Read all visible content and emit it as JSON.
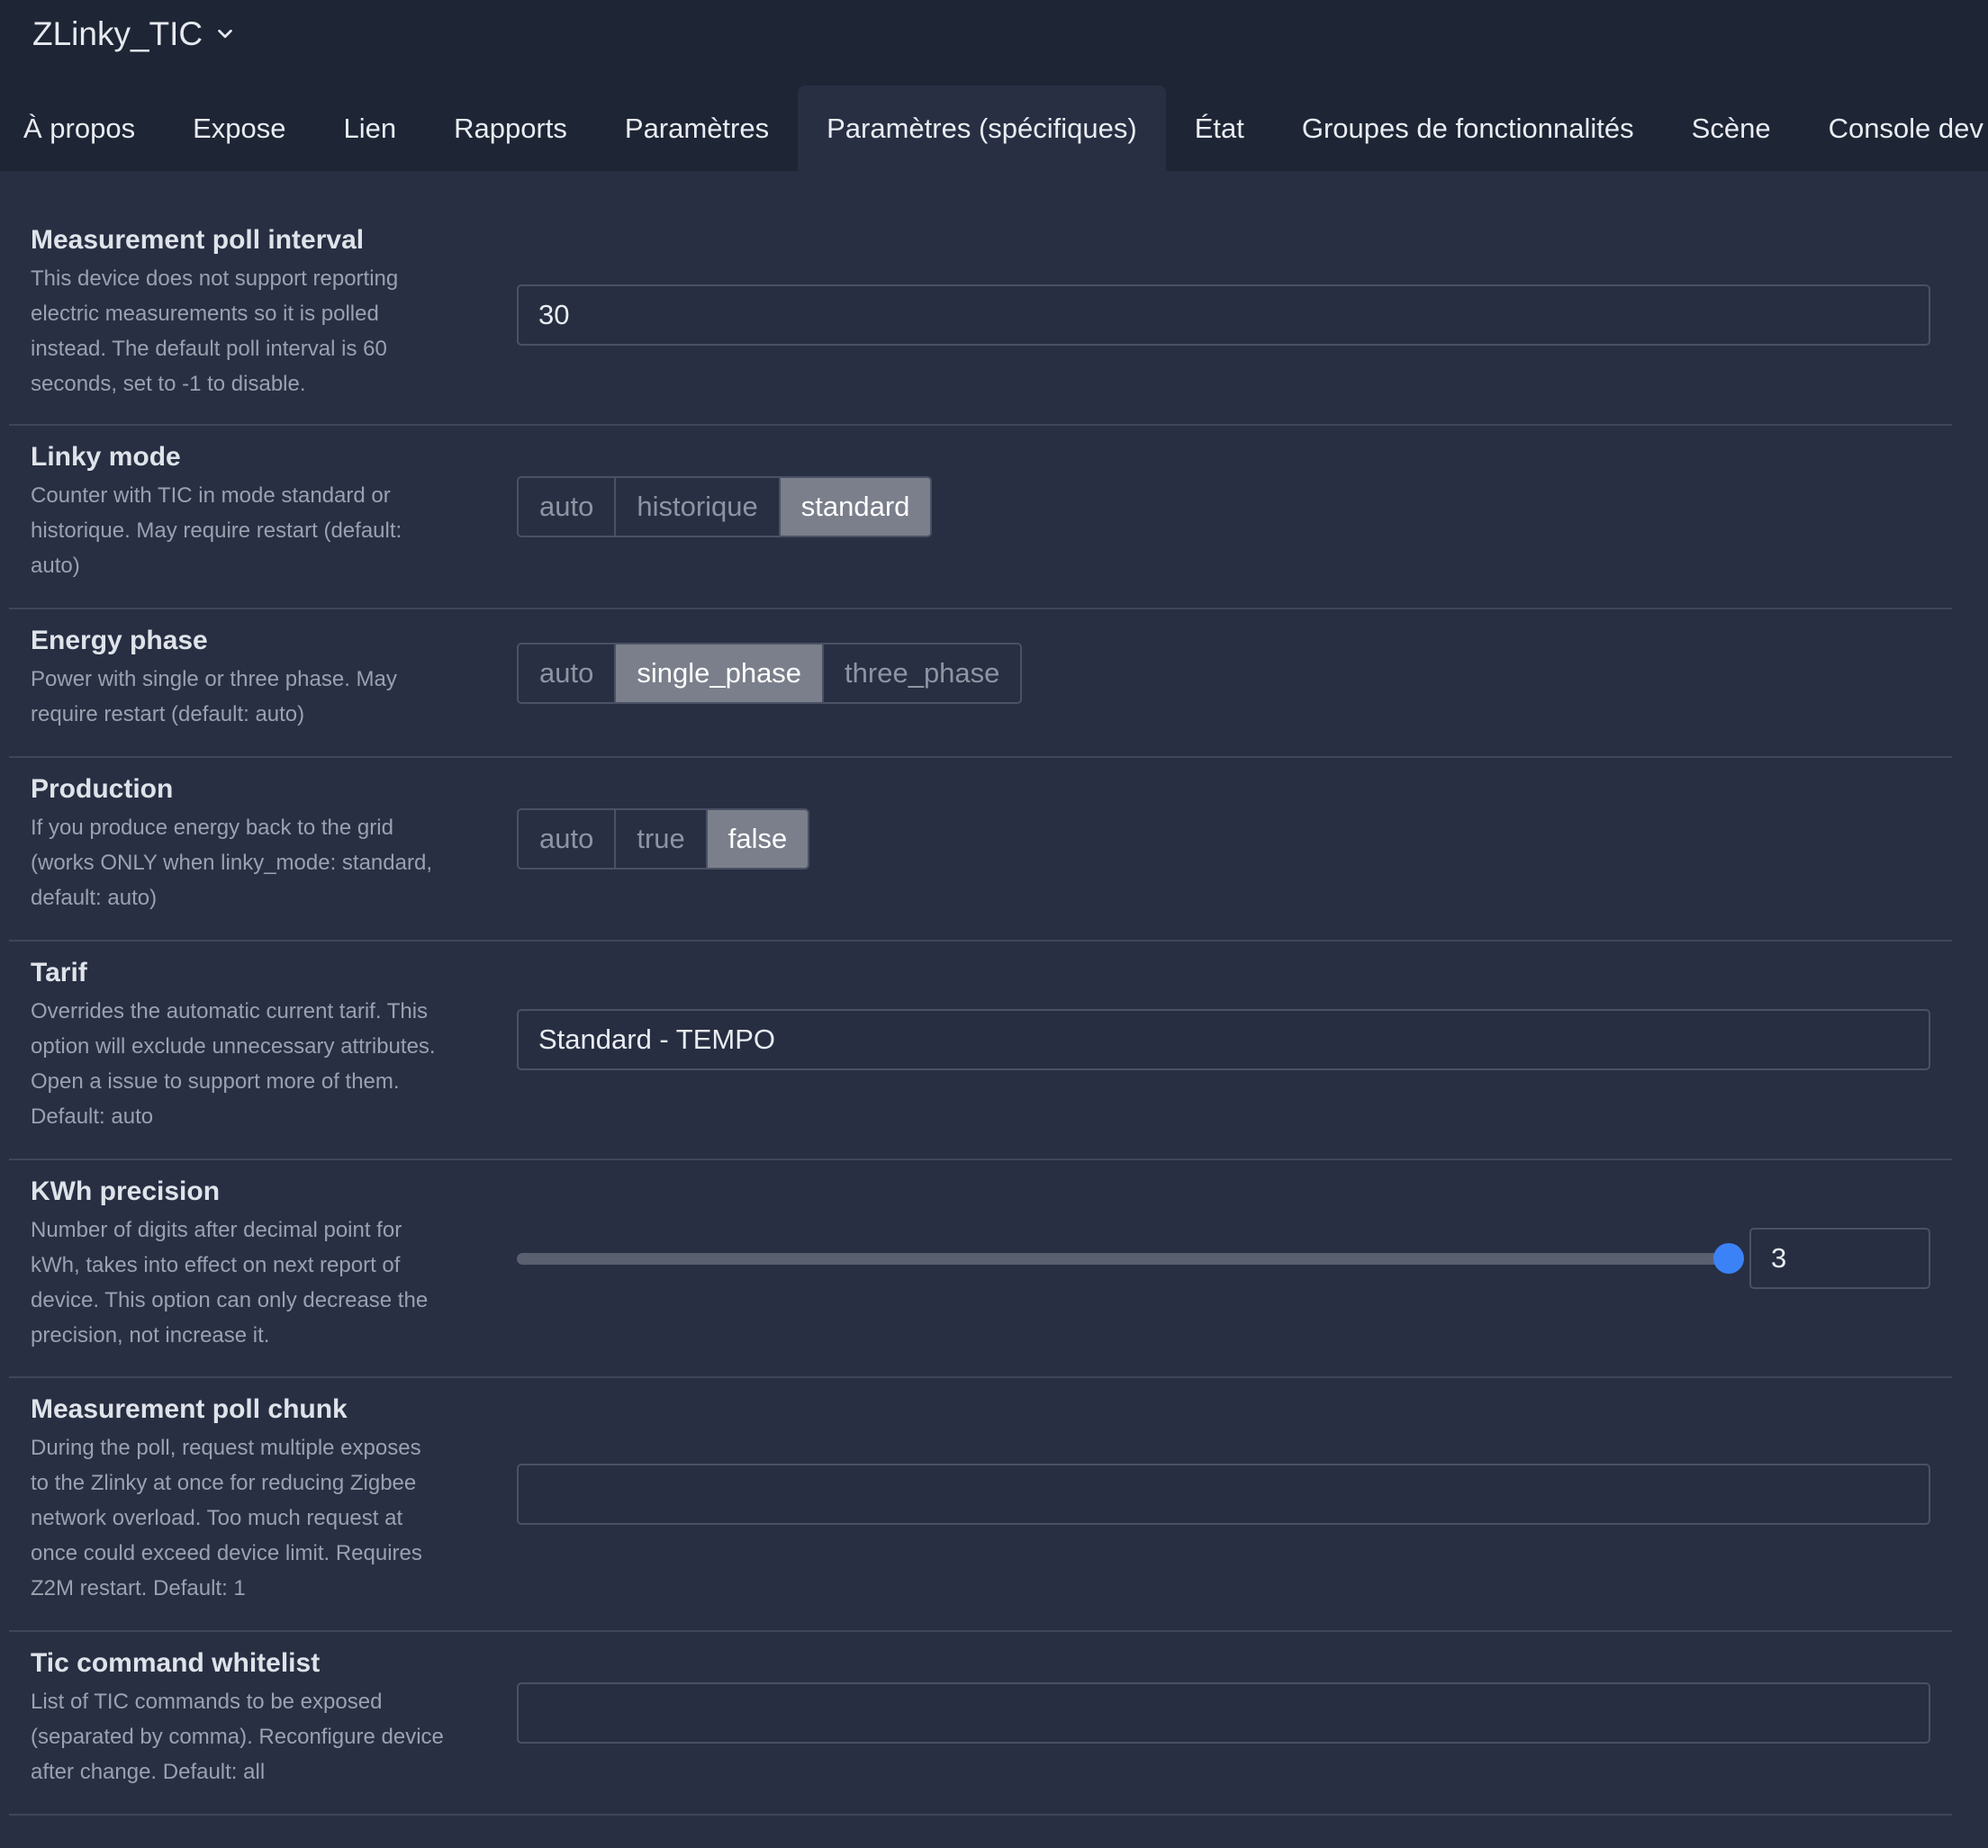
{
  "header": {
    "device_name": "ZLinky_TIC",
    "dropdown_icon": "chevron-down-icon"
  },
  "tabs": [
    {
      "label": "À propos",
      "active": false
    },
    {
      "label": "Expose",
      "active": false
    },
    {
      "label": "Lien",
      "active": false
    },
    {
      "label": "Rapports",
      "active": false
    },
    {
      "label": "Paramètres",
      "active": false
    },
    {
      "label": "Paramètres (spécifiques)",
      "active": true
    },
    {
      "label": "État",
      "active": false
    },
    {
      "label": "Groupes de fonctionnalités",
      "active": false
    },
    {
      "label": "Scène",
      "active": false
    },
    {
      "label": "Console dev",
      "active": false
    }
  ],
  "settings": {
    "measurement_poll_interval": {
      "title": "Measurement poll interval",
      "desc_lines": [
        "This device does not support reporting",
        "electric measurements so it is polled",
        "instead. The default poll interval is 60",
        "seconds, set to -1 to disable."
      ],
      "value": "30"
    },
    "linky_mode": {
      "title": "Linky mode",
      "desc_lines": [
        "Counter with TIC in mode standard or",
        "historique. May require restart (default:",
        "auto)"
      ],
      "options": [
        "auto",
        "historique",
        "standard"
      ],
      "selected": "standard"
    },
    "energy_phase": {
      "title": "Energy phase",
      "desc_lines": [
        "Power with single or three phase. May",
        "require restart (default: auto)"
      ],
      "options": [
        "auto",
        "single_phase",
        "three_phase"
      ],
      "selected": "single_phase"
    },
    "production": {
      "title": "Production",
      "desc_lines": [
        "If you produce energy back to the grid",
        "(works ONLY when linky_mode: standard,",
        "default: auto)"
      ],
      "options": [
        "auto",
        "true",
        "false"
      ],
      "selected": "false"
    },
    "tarif": {
      "title": "Tarif",
      "desc_lines": [
        "Overrides the automatic current tarif. This",
        "option will exclude unnecessary attributes.",
        "Open a issue to support more of them.",
        "Default: auto"
      ],
      "value": "Standard - TEMPO"
    },
    "kwh_precision": {
      "title": "KWh precision",
      "desc_lines": [
        "Number of digits after decimal point for",
        "kWh, takes into effect on next report of",
        "device. This option can only decrease the",
        "precision, not increase it."
      ],
      "value": "3",
      "slider_fraction": 1.0
    },
    "measurement_poll_chunk": {
      "title": "Measurement poll chunk",
      "desc_lines": [
        "During the poll, request multiple exposes",
        "to the Zlinky at once for reducing Zigbee",
        "network overload. Too much request at",
        "once could exceed device limit. Requires",
        "Z2M restart. Default: 1"
      ],
      "value": ""
    },
    "tic_command_whitelist": {
      "title": "Tic command whitelist",
      "desc_lines": [
        "List of TIC commands to be exposed",
        "(separated by comma). Reconfigure device",
        "after change. Default: all"
      ],
      "value": ""
    }
  },
  "colors": {
    "page_bg": "#282f42",
    "header_bg": "#1e2535",
    "selected_option_bg": "#7a7f8b",
    "slider_accent": "#3b82f6"
  }
}
